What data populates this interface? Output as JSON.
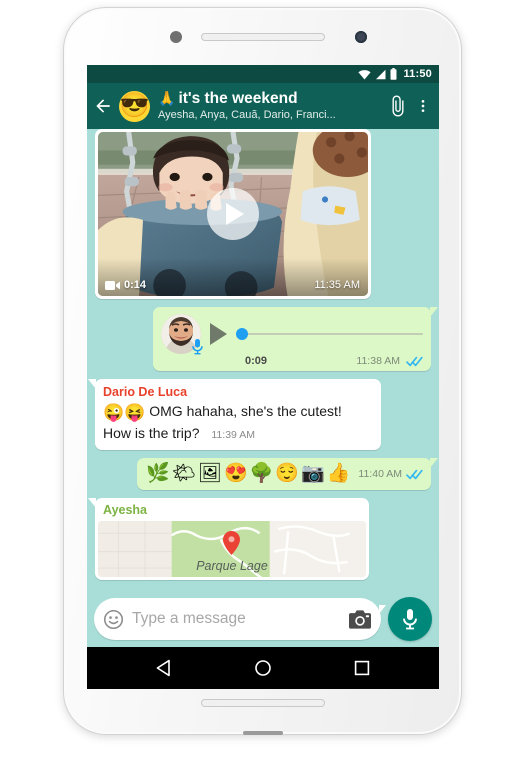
{
  "status_bar": {
    "time": "11:50",
    "icons": [
      "wifi-icon",
      "signal-icon",
      "battery-icon"
    ]
  },
  "app_bar": {
    "back_icon": "back-arrow-icon",
    "avatar_emoji": "😎",
    "title_emoji": "🙏",
    "title": "it's the weekend",
    "subtitle": "Ayesha, Anya, Cauã, Dario, Franci...",
    "attach_icon": "paperclip-icon",
    "menu_icon": "overflow-menu-icon"
  },
  "messages": [
    {
      "id": "video",
      "direction": "incoming",
      "type": "video",
      "duration": "0:14",
      "time": "11:35 AM",
      "duration_icon": "video-camera-icon",
      "play_icon": "play-icon"
    },
    {
      "id": "voice",
      "direction": "outgoing",
      "type": "voice",
      "duration": "0:09",
      "time": "11:38 AM",
      "status": "read",
      "play_icon": "play-icon",
      "mic_badge_icon": "microphone-icon"
    },
    {
      "id": "dario-text",
      "direction": "incoming",
      "type": "text",
      "sender": "Dario De Luca",
      "sender_color": "#e8412c",
      "emojis": "😜😝",
      "text": "OMG hahaha, she's the cutest! How is the trip?",
      "time": "11:39 AM"
    },
    {
      "id": "emoji-reply",
      "direction": "outgoing",
      "type": "emoji",
      "emojis": [
        "🌿",
        "🌤",
        "🖼",
        "😍",
        "🌳",
        "😌",
        "📷",
        "👍"
      ],
      "time": "11:40 AM",
      "status": "read"
    },
    {
      "id": "ayesha-location",
      "direction": "incoming",
      "type": "location",
      "sender": "Ayesha",
      "place_label": "Parque Lage",
      "pin_icon": "map-pin-icon"
    }
  ],
  "composer": {
    "emoji_icon": "smiley-icon",
    "placeholder": "Type a message",
    "value": "",
    "camera_icon": "camera-icon",
    "mic_icon": "microphone-icon",
    "mic_color": "#00897b"
  },
  "nav_bar": {
    "back_icon": "nav-back-triangle-icon",
    "home_icon": "nav-home-circle-icon",
    "recents_icon": "nav-recents-square-icon"
  },
  "theme": {
    "appbar_color": "#0f6157",
    "statusbar_color": "#0c4a42",
    "chat_background": "#a9ded8",
    "outgoing_bubble": "#dcf8c6",
    "incoming_bubble": "#ffffff",
    "read_tick_color": "#34b7f1"
  }
}
